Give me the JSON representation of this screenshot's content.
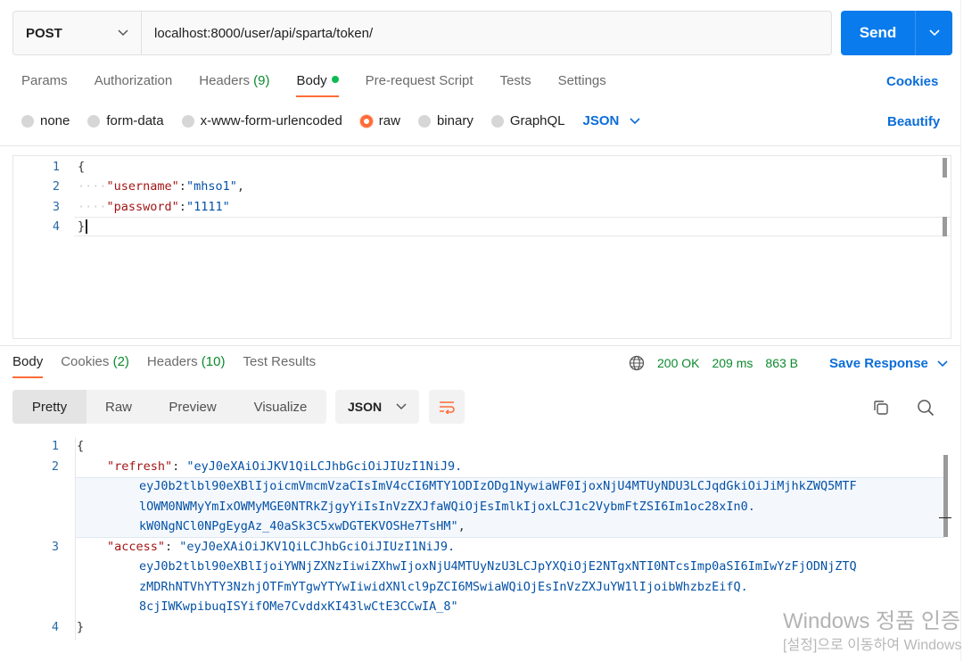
{
  "request": {
    "method": "POST",
    "url": "localhost:8000/user/api/sparta/token/",
    "send_label": "Send"
  },
  "request_tabs": [
    {
      "label": "Params"
    },
    {
      "label": "Authorization"
    },
    {
      "label": "Headers",
      "count": "(9)"
    },
    {
      "label": "Body"
    },
    {
      "label": "Pre-request Script"
    },
    {
      "label": "Tests"
    },
    {
      "label": "Settings"
    }
  ],
  "cookies_link": "Cookies",
  "body_types": [
    "none",
    "form-data",
    "x-www-form-urlencoded",
    "raw",
    "binary",
    "GraphQL"
  ],
  "body_format": "JSON",
  "beautify_label": "Beautify",
  "request_body": {
    "line_numbers": [
      "1",
      "2",
      "3",
      "4"
    ],
    "open_brace": "{",
    "close_brace": "}",
    "username_key": "\"username\"",
    "username_value": "\"mhso1\"",
    "password_key": "\"password\"",
    "password_value": "\"1111\""
  },
  "response_tabs": [
    {
      "label": "Body"
    },
    {
      "label": "Cookies",
      "count": "(2)"
    },
    {
      "label": "Headers",
      "count": "(10)"
    },
    {
      "label": "Test Results"
    }
  ],
  "status": {
    "code": "200 OK",
    "time": "209 ms",
    "size": "863 B"
  },
  "save_response_label": "Save Response",
  "view_modes": [
    "Pretty",
    "Raw",
    "Preview",
    "Visualize"
  ],
  "response_format": "JSON",
  "response_body": {
    "line_numbers": [
      "1",
      "2",
      "3",
      "4"
    ],
    "open_brace": "{",
    "close_brace": "}",
    "refresh_key": "\"refresh\"",
    "refresh_lines": [
      "\"eyJ0eXAiOiJKV1QiLCJhbGciOiJIUzI1NiJ9.",
      "eyJ0b2tlbl90eXBlIjoicmVmcmVzaCIsImV4cCI6MTY1ODIzODg1NywiaWF0IjoxNjU4MTUyNDU3LCJqdGkiOiJiMjhkZWQ5MTF",
      "lOWM0NWMyYmIxOWMyMGE0NTRkZjgyYiIsInVzZXJfaWQiOjEsImlkIjoxLCJ1c2VybmFtZSI6Im1oc28xIn0.",
      "kW0NgNCl0NPgEygAz_40aSk3C5xwDGTEKVOSHe7TsHM\""
    ],
    "access_key": "\"access\"",
    "access_lines": [
      "\"eyJ0eXAiOiJKV1QiLCJhbGciOiJIUzI1NiJ9.",
      "eyJ0b2tlbl90eXBlIjoiYWNjZXNzIiwiZXhwIjoxNjU4MTUyNzU3LCJpYXQiOjE2NTgxNTI0NTcsImp0aSI6ImIwYzFjODNjZTQ",
      "zMDRhNTVhYTY3NzhjOTFmYTgwYTYwIiwidXNlcl9pZCI6MSwiaWQiOjEsInVzZXJuYW1lIjoibWhzbzEifQ.",
      "8cjIWKwpibuqISYifOMe7CvddxKI43lwCtE3CCwIA_8\""
    ]
  },
  "os_watermark": {
    "line1": "Windows 정품 인증",
    "line2": "[설정]으로 이동하여 Windows"
  },
  "colors": {
    "accent": "#ff6c37",
    "primary": "#097bed",
    "link": "#0b6dd8",
    "success": "#0c8a2e"
  }
}
